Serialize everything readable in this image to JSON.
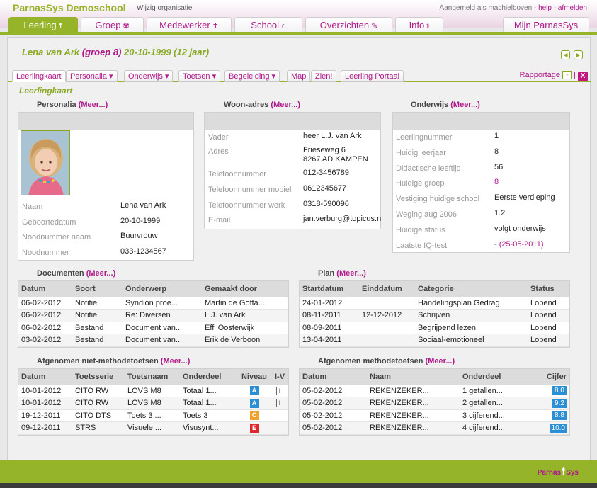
{
  "header": {
    "app_title": "ParnasSys Demoschool",
    "wijzig": "Wijzig organisatie",
    "logged_in_text": "Aangemeld als machielboven",
    "sep1": " - ",
    "help": "help",
    "sep2": " - ",
    "afmelden": "afmelden"
  },
  "nav": {
    "tabs": [
      {
        "label": "Leerling",
        "icon": "☨"
      },
      {
        "label": "Groep",
        "icon": "✾"
      },
      {
        "label": "Medewerker",
        "icon": "✝"
      },
      {
        "label": "School",
        "icon": "⌂"
      },
      {
        "label": "Overzichten",
        "icon": "✎"
      },
      {
        "label": "Info",
        "icon": "ℹ"
      },
      {
        "label": "Mijn ParnasSys",
        "icon": ""
      }
    ]
  },
  "student": {
    "name": "Lena van Ark",
    "group": "(groep 8)",
    "dob_age": "20-10-1999 (12 jaar)"
  },
  "subtabs": [
    "Leerlingkaart",
    "Personalia ▾",
    "Onderwijs ▾",
    "Toetsen ▾",
    "Begeleiding ▾",
    "Map",
    "Zien!",
    "Leerling Portaal"
  ],
  "rapportage": "Rapportage",
  "rapportage_sep": "|",
  "close": "X",
  "section_title": "Leerlingkaart",
  "personalia": {
    "title": "Personalia",
    "meer": "(Meer...)",
    "rows": [
      {
        "label": "Naam",
        "value": "Lena van Ark"
      },
      {
        "label": "Geboortedatum",
        "value": "20-10-1999"
      },
      {
        "label": "Noodnummer naam",
        "value": "Buurvrouw"
      },
      {
        "label": "Noodnummer",
        "value": "033-1234567"
      }
    ]
  },
  "woonadres": {
    "title": "Woon-adres",
    "meer": "(Meer...)",
    "rows": [
      {
        "label": "Vader",
        "value": "heer L.J. van Ark",
        "value2": ""
      },
      {
        "label": "Adres",
        "value": "Frieseweg 6",
        "value2": "8267 AD KAMPEN"
      },
      {
        "label": "Telefoonnummer",
        "value": "012-3456789",
        "value2": ""
      },
      {
        "label": "Telefoonnummer mobiel",
        "value": "0612345677",
        "value2": ""
      },
      {
        "label": "Telefoonnummer werk",
        "value": "0318-590096",
        "value2": ""
      },
      {
        "label": "E-mail",
        "value": "jan.verburg@topicus.nl",
        "value2": ""
      }
    ]
  },
  "onderwijs": {
    "title": "Onderwijs",
    "meer": "(Meer...)",
    "rows": [
      {
        "label": "Leerlingnummer",
        "value": "1"
      },
      {
        "label": "Huidig leerjaar",
        "value": "8"
      },
      {
        "label": "Didactische leeftijd",
        "value": "56"
      },
      {
        "label": "Huidige groep",
        "value": "8"
      },
      {
        "label": "Vestiging huidige school",
        "value": "Eerste verdieping"
      },
      {
        "label": "Weging aug 2006",
        "value": "1.2"
      },
      {
        "label": "Huidige status",
        "value": "volgt onderwijs"
      },
      {
        "label": "Laatste IQ-test",
        "value": "- (25-05-2011)"
      }
    ]
  },
  "documenten": {
    "title": "Documenten",
    "meer": "(Meer...)",
    "headers": [
      "Datum",
      "Soort",
      "Onderwerp",
      "Gemaakt door"
    ],
    "rows": [
      [
        "06-02-2012",
        "Notitie",
        "Syndion proe...",
        "Martin de Goffa..."
      ],
      [
        "06-02-2012",
        "Notitie",
        "Re: Diversen",
        "L.J. van Ark"
      ],
      [
        "06-02-2012",
        "Bestand",
        "Document van...",
        "Effi Oosterwijk"
      ],
      [
        "03-02-2012",
        "Bestand",
        "Document van...",
        "Erik de Verboon"
      ]
    ]
  },
  "plan": {
    "title": "Plan",
    "meer": "(Meer...)",
    "headers": [
      "Startdatum",
      "Einddatum",
      "Categorie",
      "Status"
    ],
    "rows": [
      [
        "24-01-2012",
        "",
        "Handelingsplan Gedrag",
        "Lopend"
      ],
      [
        "08-11-2011",
        "12-12-2012",
        "Schrijven",
        "Lopend"
      ],
      [
        "08-09-2011",
        "",
        "Begrijpend lezen",
        "Lopend"
      ],
      [
        "13-04-2011",
        "",
        "Sociaal-emotioneel",
        "Lopend"
      ]
    ]
  },
  "niet_methode": {
    "title": "Afgenomen niet-methodetoetsen",
    "meer": "(Meer...)",
    "headers": [
      "Datum",
      "Toetsserie",
      "Toetsnaam",
      "Onderdeel",
      "Niveau",
      "I-V"
    ],
    "rows": [
      [
        "10-01-2012",
        "CITO RW",
        "LOVS M8",
        "Totaal 1...",
        "A",
        "I"
      ],
      [
        "10-01-2012",
        "CITO RW",
        "LOVS M8",
        "Totaal 1...",
        "A",
        "I"
      ],
      [
        "19-12-2011",
        "CITO DTS",
        "Toets 3 ...",
        "Toets 3",
        "C",
        ""
      ],
      [
        "09-12-2011",
        "STRS",
        "Visuele ...",
        "Visusynt...",
        "E",
        ""
      ]
    ]
  },
  "methode": {
    "title": "Afgenomen methodetoetsen",
    "meer": "(Meer...)",
    "headers": [
      "Datum",
      "Naam",
      "Onderdeel",
      "Cijfer"
    ],
    "rows": [
      [
        "05-02-2012",
        "REKENZEKER...",
        "1 getallen...",
        "8.0"
      ],
      [
        "05-02-2012",
        "REKENZEKER...",
        "2 getallen...",
        "9.2"
      ],
      [
        "05-02-2012",
        "REKENZEKER...",
        "3 cijferend...",
        "8.8"
      ],
      [
        "05-02-2012",
        "REKENZEKER...",
        "4 cijferend...",
        "10.0"
      ]
    ]
  },
  "footer": {
    "logo": "Parnas",
    "logo2": "Sys"
  },
  "colors": {
    "accent_green": "#96b42a",
    "accent_magenta": "#b0198a",
    "badge_blue": "#2b8fd6",
    "badge_orange": "#f0a22a",
    "badge_red": "#e0272a"
  }
}
